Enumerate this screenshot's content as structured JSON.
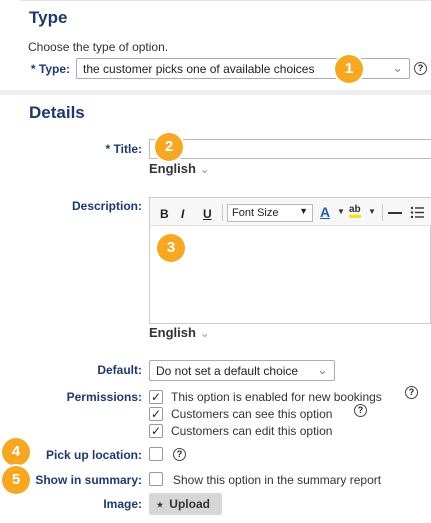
{
  "type_section": {
    "title": "Type",
    "subtitle": "Choose the type of option.",
    "type_label": "* Type:",
    "type_value": "the customer picks one of available choices",
    "badge": "1"
  },
  "details_section": {
    "title": "Details",
    "title_label": "* Title:",
    "title_badge": "2",
    "title_lang": "English",
    "description_label": "Description:",
    "toolbar": {
      "bold": "B",
      "italic": "I",
      "underline": "U",
      "font_size": "Font Size",
      "font_color": "A",
      "highlight": "ab"
    },
    "description_badge": "3",
    "description_lang": "English",
    "default_label": "Default:",
    "default_value": "Do not set a default choice",
    "permissions_label": "Permissions:",
    "permissions": [
      {
        "label": "This option is enabled for new bookings",
        "checked": true,
        "help": true
      },
      {
        "label": "Customers can see this option",
        "checked": true,
        "help": true
      },
      {
        "label": "Customers can edit this option",
        "checked": true,
        "help": false
      }
    ],
    "pickup_label": "Pick up location:",
    "pickup_badge": "4",
    "summary_label": "Show in summary:",
    "summary_badge": "5",
    "summary_text": "Show this option in the summary report",
    "image_label": "Image:",
    "upload_label": "Upload"
  }
}
